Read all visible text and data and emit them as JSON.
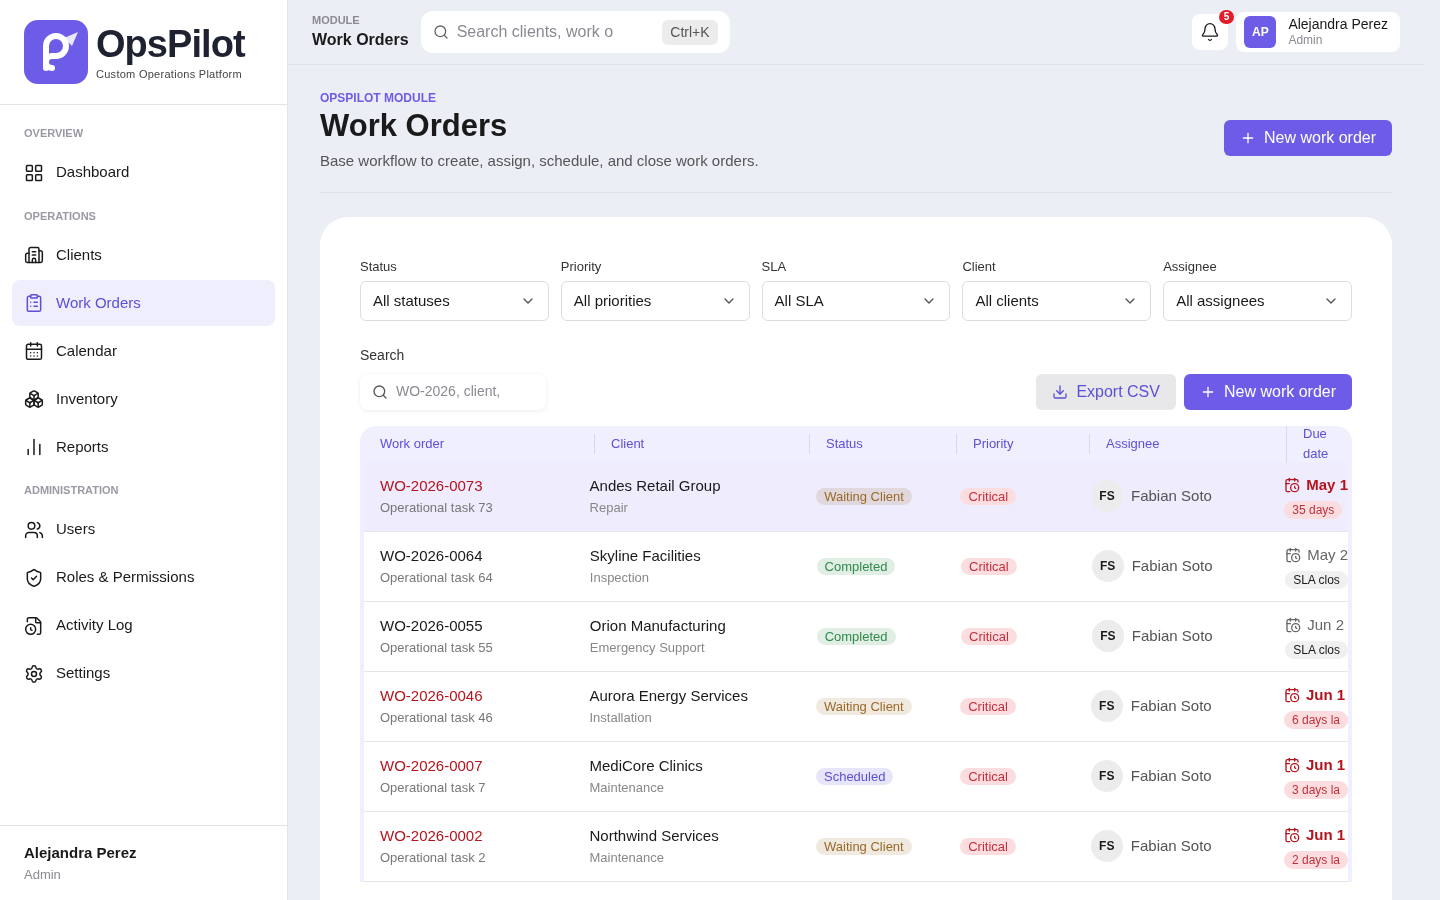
{
  "brand": {
    "name": "OpsPilot",
    "tagline": "Custom Operations Platform"
  },
  "sidebar": {
    "sections": [
      {
        "title": "OVERVIEW",
        "items": [
          {
            "label": "Dashboard",
            "selected": false
          }
        ]
      },
      {
        "title": "OPERATIONS",
        "items": [
          {
            "label": "Clients",
            "selected": false
          },
          {
            "label": "Work Orders",
            "selected": true
          },
          {
            "label": "Calendar",
            "selected": false
          },
          {
            "label": "Inventory",
            "selected": false
          },
          {
            "label": "Reports",
            "selected": false
          }
        ]
      },
      {
        "title": "ADMINISTRATION",
        "items": [
          {
            "label": "Users",
            "selected": false
          },
          {
            "label": "Roles & Permissions",
            "selected": false
          },
          {
            "label": "Activity Log",
            "selected": false
          },
          {
            "label": "Settings",
            "selected": false
          }
        ]
      }
    ],
    "user": {
      "name": "Alejandra Perez",
      "role": "Admin"
    }
  },
  "topbar": {
    "module_label": "MODULE",
    "module": "Work Orders",
    "search": {
      "placeholder": "Search clients, work o"
    },
    "shortcut": "Ctrl+K",
    "notifications": "5",
    "user": {
      "initials": "AP",
      "name": "Alejandra Perez",
      "role": "Admin"
    }
  },
  "page": {
    "eyebrow": "OPSPILOT MODULE",
    "title": "Work Orders",
    "subtitle": "Base workflow to create, assign, schedule, and close work orders.",
    "primary_button": "New work order"
  },
  "filters": [
    {
      "label": "Status",
      "value": "All statuses"
    },
    {
      "label": "Priority",
      "value": "All priorities"
    },
    {
      "label": "SLA",
      "value": "All SLA"
    },
    {
      "label": "Client",
      "value": "All clients"
    },
    {
      "label": "Assignee",
      "value": "All assignees"
    }
  ],
  "search": {
    "label": "Search",
    "placeholder": "WO-2026, client,"
  },
  "actions": {
    "export": "Export CSV",
    "new": "New work order"
  },
  "table": {
    "columns": [
      "Work order",
      "Client",
      "Status",
      "Priority",
      "Assignee",
      "Due date"
    ],
    "rows": [
      {
        "selected": true,
        "overdue": true,
        "id": "WO-2026-0073",
        "task": "Operational task 73",
        "client": "Andes Retail Group",
        "type": "Repair",
        "status": "Waiting Client",
        "color": "#9a6a2a",
        "priority": "Critical",
        "initials": "FS",
        "assignee": "Fabian Soto",
        "due": "May 1",
        "sla": "35 days"
      },
      {
        "selected": false,
        "overdue": false,
        "id": "WO-2026-0064",
        "task": "Operational task 64",
        "client": "Skyline Facilities",
        "type": "Inspection",
        "status": "Completed",
        "color": "#2f8a4c",
        "priority": "Critical",
        "initials": "FS",
        "assignee": "Fabian Soto",
        "due": "May 2",
        "sla": "SLA clos"
      },
      {
        "selected": false,
        "overdue": false,
        "id": "WO-2026-0055",
        "task": "Operational task 55",
        "client": "Orion Manufacturing",
        "type": "Emergency Support",
        "status": "Completed",
        "color": "#2f8a4c",
        "priority": "Critical",
        "initials": "FS",
        "assignee": "Fabian Soto",
        "due": "Jun 2",
        "sla": "SLA clos"
      },
      {
        "selected": false,
        "overdue": true,
        "id": "WO-2026-0046",
        "task": "Operational task 46",
        "client": "Aurora Energy Services",
        "type": "Installation",
        "status": "Waiting Client",
        "color": "#9a6a2a",
        "priority": "Critical",
        "initials": "FS",
        "assignee": "Fabian Soto",
        "due": "Jun 1",
        "sla": "6 days la"
      },
      {
        "selected": false,
        "overdue": true,
        "id": "WO-2026-0007",
        "task": "Operational task 7",
        "client": "MediCore Clinics",
        "type": "Maintenance",
        "status": "Scheduled",
        "color": "#5b50d6",
        "priority": "Critical",
        "initials": "FS",
        "assignee": "Fabian Soto",
        "due": "Jun 1",
        "sla": "3 days la"
      },
      {
        "selected": false,
        "overdue": true,
        "id": "WO-2026-0002",
        "task": "Operational task 2",
        "client": "Northwind Services",
        "type": "Maintenance",
        "status": "Waiting Client",
        "color": "#9a6a2a",
        "priority": "Critical",
        "initials": "FS",
        "assignee": "Fabian Soto",
        "due": "Jun 1",
        "sla": "2 days la"
      }
    ]
  }
}
